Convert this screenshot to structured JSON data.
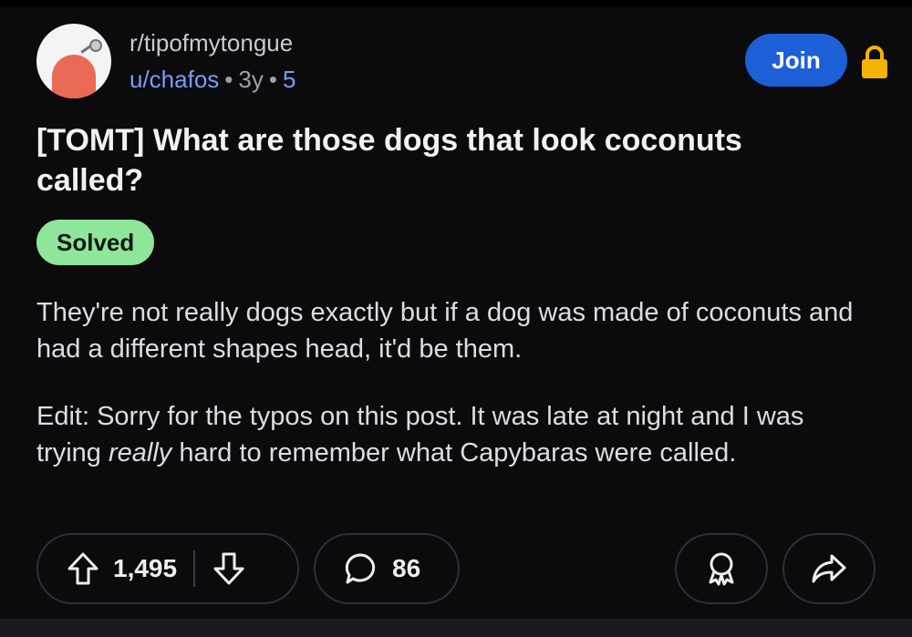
{
  "header": {
    "subreddit": "r/tipofmytongue",
    "author": "u/chafos",
    "age": "3y",
    "extra": "5",
    "join_label": "Join"
  },
  "post": {
    "title": "[TOMT] What are those dogs that look coconuts called?",
    "flair": "Solved",
    "body_para1": "They're not really dogs exactly but if a dog was made of coconuts and had a different shapes head, it'd be them.",
    "body_para2_before": "Edit: Sorry for the typos on this post. It was late at night and I was trying ",
    "body_para2_emphasis": "really",
    "body_para2_after": " hard to remember what Capybaras were called."
  },
  "actions": {
    "upvotes": "1,495",
    "comments": "86"
  },
  "icons": {
    "upvote": "arrow-up-icon",
    "downvote": "arrow-down-icon",
    "comment": "speech-bubble-icon",
    "award": "award-icon",
    "share": "share-icon",
    "lock": "lock-icon"
  },
  "colors": {
    "background": "#0b0b0d",
    "join": "#1d5fd6",
    "flair": "#8fe59a",
    "lock": "#f5b301",
    "meta_link": "#7a9cf3"
  }
}
